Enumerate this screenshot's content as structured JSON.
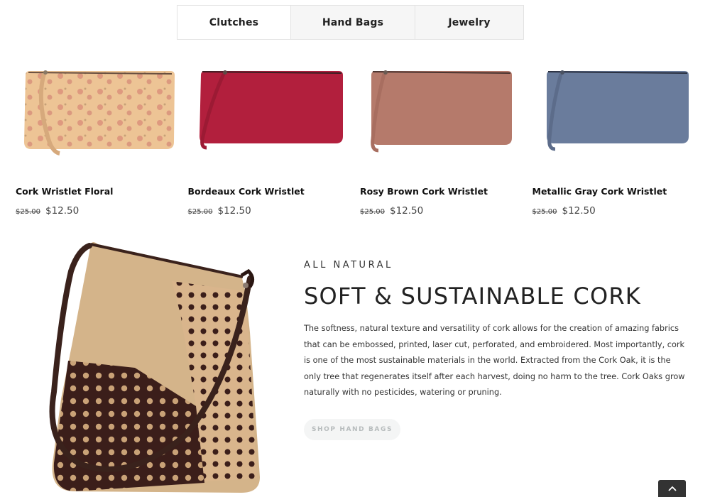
{
  "tabs": [
    {
      "label": "Clutches"
    },
    {
      "label": "Hand Bags"
    },
    {
      "label": "Jewelry"
    }
  ],
  "products": [
    {
      "name": "Cork Wristlet Floral",
      "old_price": "$25.00",
      "price": "$12.50",
      "color": "#e8b98c",
      "image": "floral-cork-wristlet"
    },
    {
      "name": "Bordeaux Cork Wristlet",
      "old_price": "$25.00",
      "price": "$12.50",
      "color": "#b0213c",
      "image": "bordeaux-cork-wristlet"
    },
    {
      "name": "Rosy Brown Cork Wristlet",
      "old_price": "$25.00",
      "price": "$12.50",
      "color": "#b77a6c",
      "image": "rosy-brown-cork-wristlet"
    },
    {
      "name": "Metallic Gray Cork Wristlet",
      "old_price": "$25.00",
      "price": "$12.50",
      "color": "#6a7a99",
      "image": "metallic-gray-cork-wristlet"
    }
  ],
  "feature": {
    "eyebrow": "ALL NATURAL",
    "headline": "SOFT & SUSTAINABLE CORK",
    "body": "The softness, natural texture and versatility of cork allows for the creation of amazing fabrics that can be embossed, printed, laser cut, perforated, and embroidered. Most importantly, cork is one of the most sustainable materials in the world. Extracted from the Cork Oak, it is the only tree that regenerates itself after each harvest, doing no harm to the tree. Cork Oaks grow naturally with no pesticides, watering or pruning.",
    "cta_label": "SHOP HAND BAGS",
    "image": "cork-handbag-photo"
  },
  "scroll_top": {
    "icon": "chevron-up-icon"
  }
}
